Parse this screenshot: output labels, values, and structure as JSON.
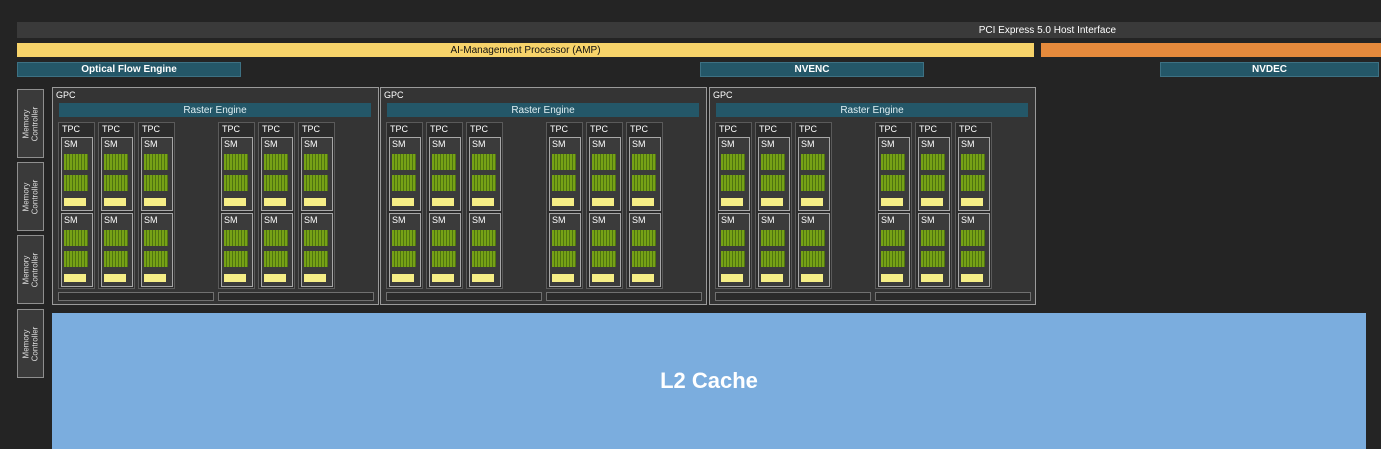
{
  "top": {
    "pcie": "PCI Express 5.0 Host Interface",
    "amp": "AI-Management Processor (AMP)"
  },
  "engines": {
    "optical_flow": "Optical Flow Engine",
    "nvenc": "NVENC",
    "nvdec": "NVDEC"
  },
  "memory_controllers": [
    "Memory\nController",
    "Memory\nController",
    "Memory\nController",
    "Memory\nController"
  ],
  "gpcs": [
    {
      "label": "GPC",
      "raster": "Raster Engine",
      "tpcs": [
        "TPC",
        "TPC",
        "TPC",
        "TPC",
        "TPC",
        "TPC"
      ],
      "sm_label": "SM"
    },
    {
      "label": "GPC",
      "raster": "Raster Engine",
      "tpcs": [
        "TPC",
        "TPC",
        "TPC",
        "TPC",
        "TPC",
        "TPC"
      ],
      "sm_label": "SM"
    },
    {
      "label": "GPC",
      "raster": "Raster Engine",
      "tpcs": [
        "TPC",
        "TPC",
        "TPC",
        "TPC",
        "TPC",
        "TPC"
      ],
      "sm_label": "SM"
    }
  ],
  "l2": "L2 Cache",
  "colors": {
    "amp": "#f7d36a",
    "orange_bar": "#e58a3c",
    "engine_blue": "#245768",
    "l2_blue": "#7badde",
    "sm_green": "#76a216",
    "sm_yellow": "#f6ee86"
  }
}
